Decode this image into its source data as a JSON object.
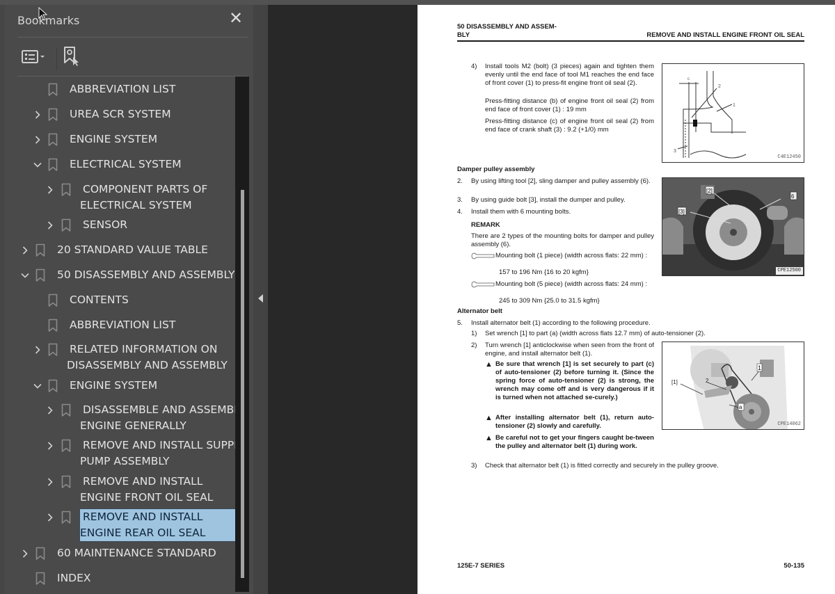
{
  "sidebar": {
    "title": "Bookmarks",
    "close_icon": "close-icon",
    "toolbar": {
      "options_icon": "list-options-icon",
      "find_icon": "find-current-bookmark-icon"
    },
    "tree": [
      {
        "label": "ABBREVIATION LIST",
        "level": 2,
        "expander": "none"
      },
      {
        "label": "UREA SCR SYSTEM",
        "level": 2,
        "expander": "collapsed"
      },
      {
        "label": "ENGINE SYSTEM",
        "level": 2,
        "expander": "collapsed"
      },
      {
        "label": "ELECTRICAL SYSTEM",
        "level": 2,
        "expander": "expanded"
      },
      {
        "label": "COMPONENT PARTS OF",
        "label2": "ELECTRICAL SYSTEM",
        "level": 3,
        "expander": "collapsed"
      },
      {
        "label": "SENSOR",
        "level": 3,
        "expander": "collapsed"
      },
      {
        "label": "20 STANDARD VALUE TABLE",
        "level": 1,
        "expander": "collapsed"
      },
      {
        "label": "50 DISASSEMBLY AND ASSEMBLY",
        "level": 1,
        "expander": "expanded"
      },
      {
        "label": "CONTENTS",
        "level": 2,
        "expander": "none"
      },
      {
        "label": "ABBREVIATION LIST",
        "level": 2,
        "expander": "none"
      },
      {
        "label": "RELATED INFORMATION ON",
        "label2": "DISASSEMBLY AND ASSEMBLY",
        "level": 2,
        "expander": "collapsed"
      },
      {
        "label": "ENGINE SYSTEM",
        "level": 2,
        "expander": "expanded"
      },
      {
        "label": "DISASSEMBLE AND ASSEMBLE",
        "label2": "ENGINE GENERALLY",
        "level": 3,
        "expander": "collapsed"
      },
      {
        "label": "REMOVE AND INSTALL SUPPLY",
        "label2": "PUMP ASSEMBLY",
        "level": 3,
        "expander": "collapsed"
      },
      {
        "label": "REMOVE AND INSTALL",
        "label2": "ENGINE FRONT OIL SEAL",
        "level": 3,
        "expander": "collapsed"
      },
      {
        "label": "REMOVE AND INSTALL",
        "label2": "ENGINE REAR OIL SEAL",
        "level": 3,
        "expander": "collapsed",
        "selected": true
      },
      {
        "label": "60 MAINTENANCE STANDARD",
        "level": 1,
        "expander": "collapsed"
      },
      {
        "label": "INDEX",
        "level": 1,
        "expander": "none"
      }
    ],
    "selection_color": "#9ec4e0"
  },
  "page": {
    "header_left_1": "50 DISASSEMBLY AND ASSEM-",
    "header_left_2": "BLY",
    "header_right": "REMOVE AND INSTALL ENGINE FRONT OIL SEAL",
    "step4_num": "4)",
    "step4_text": "Install tools M2 (bolt) (3 pieces) again and tighten them evenly until the end face of tool M1 reaches the end face of front cover (1) to press-fit engine front oil seal (2).",
    "step4_b": "Press-fitting distance (b) of engine front oil seal (2) from end face of front cover (1) : 19 mm",
    "step4_c": "Press-fitting distance (c) of engine front oil seal (2) from end face of crank shaft (3) : 9.2 (+1/0) mm",
    "fig1_id": "C4E12450",
    "fig1_labels": [
      "c",
      "2",
      "1",
      "3"
    ],
    "damper_heading": "Damper pulley assembly",
    "d_steps": [
      {
        "num": "2.",
        "text": "By using lifting tool [2], sling damper and pulley assembly (6)."
      },
      {
        "num": "3.",
        "text": "By using guide bolt [3], install the dumper and pulley."
      },
      {
        "num": "4.",
        "text": "Install them with 6 mounting bolts."
      }
    ],
    "remark_title": "REMARK",
    "remark_text": "There are 2 types of the mounting bolts for damper and pulley assembly (6).",
    "torque1_text": "Mounting bolt (1 piece) (width across flats: 22 mm) :",
    "torque1_value": "157 to 196 Nm {16 to 20 kgfm}",
    "torque2_text": "Mounting bolt (5 piece) (width across flats: 24 mm) :",
    "torque2_value": "245 to 309 Nm {25.0 to 31.5 kgfm}",
    "fig2_id": "CPE12500",
    "fig2_labels": [
      "[2]",
      "[3]",
      "6"
    ],
    "alt_heading": "Alternator belt",
    "step5_num": "5.",
    "step5_text": "Install alternator belt (1) according to the following procedure.",
    "sub1_num": "1)",
    "sub1_text": "Set wrench [1] to part (a) (width across flats 12.7 mm) of auto-tensioner (2).",
    "sub2_num": "2)",
    "sub2_text": "Turn wrench [1] anticlockwise when seen from the front of engine, and install alternator belt (1).",
    "warn1": "Be sure that wrench [1] is set securely to part (c) of auto-tensioner (2) before turning it. (Since the spring force of auto-tensioner (2) is strong, the wrench may come off and is very dangerous if it is turned when not attached se-curely.)",
    "warn2": "After installing alternator belt (1), return auto-tensioner (2) slowly and carefully.",
    "warn3": "Be careful not to get your fingers caught be-tween the pulley and alternator belt (1) during work.",
    "sub3_num": "3)",
    "sub3_text": "Check that alternator belt (1) is fitted correctly and securely in the pulley groove.",
    "fig3_id": "CPE14062",
    "fig3_labels": [
      "[1]",
      "2",
      "1",
      "a"
    ],
    "footer_left": "125E-7 SERIES",
    "footer_right": "50-135"
  }
}
